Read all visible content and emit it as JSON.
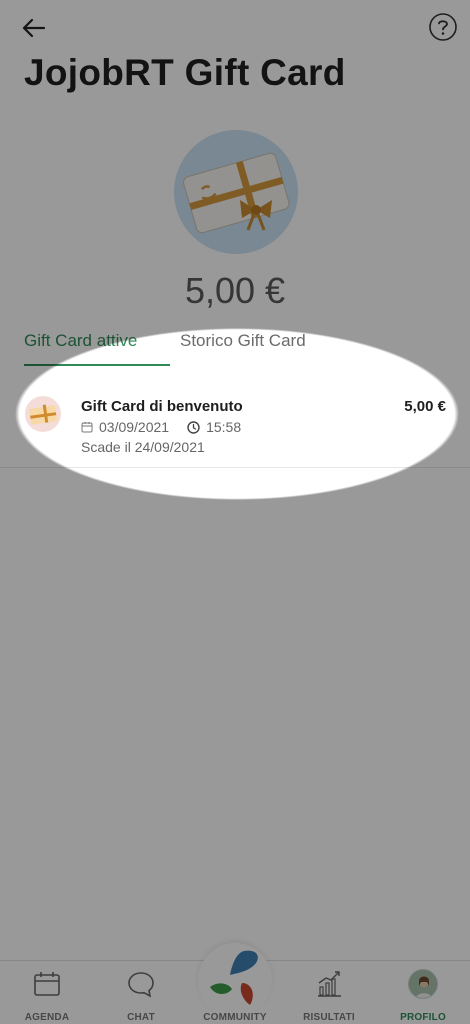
{
  "header": {
    "back_icon": "arrow-left-icon",
    "help_icon": "question-circle-icon",
    "title": "JojobRT Gift Card"
  },
  "hero": {
    "image": "gift-card-illustration",
    "balance": "5,00 €"
  },
  "tabs": [
    {
      "label": "Gift Card attive",
      "active": true
    },
    {
      "label": "Storico Gift Card",
      "active": false
    }
  ],
  "gift_cards": [
    {
      "title": "Gift Card di benvenuto",
      "amount": "5,00 €",
      "date": "03/09/2021",
      "time": "15:58",
      "expiry": "Scade il 24/09/2021"
    }
  ],
  "bottom_nav": {
    "items": [
      {
        "label": "AGENDA",
        "icon": "calendar-icon",
        "active": false
      },
      {
        "label": "CHAT",
        "icon": "chat-bubble-icon",
        "active": false
      },
      {
        "label": "COMMUNITY",
        "icon": "leaves-icon",
        "active": false
      },
      {
        "label": "RISULTATI",
        "icon": "chart-icon",
        "active": false
      },
      {
        "label": "PROFILO",
        "icon": "avatar",
        "active": true
      }
    ]
  },
  "colors": {
    "accent": "#2e8a57",
    "text": "#1f1f1f",
    "muted": "#666666",
    "overlay": "rgba(0,0,0,0.40)"
  }
}
